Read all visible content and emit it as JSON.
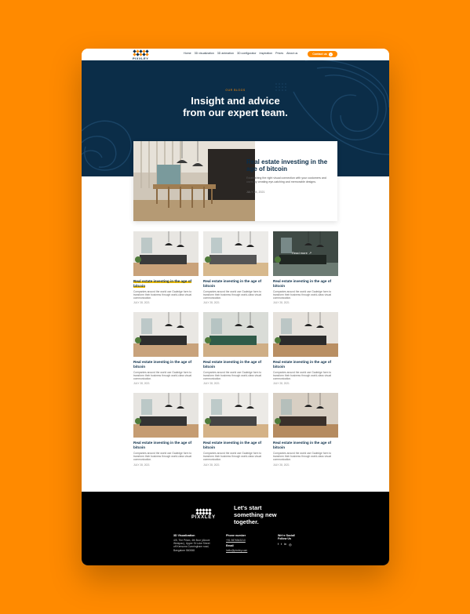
{
  "nav": {
    "logo_text": "PIXXLEY",
    "items": [
      "Home",
      "3D visualization",
      "3D animation",
      "3D configurator",
      "Inspiration",
      "Prices",
      "About us"
    ],
    "contact_label": "Contact us"
  },
  "hero": {
    "eyebrow": "OUR BLOGS",
    "title_line1": "Insight and advice",
    "title_line2": "from our expert team."
  },
  "featured": {
    "title": "Real estate investing in the age of bitcoin",
    "description": "Establishing the right visual connection with your customers and users by creating eye-catching and memorable designs.",
    "date": "JULY 28, 2021"
  },
  "cards": [
    {
      "title": "Real estate investing in the age of bitcoin",
      "desc": "Companies around the world use Gadedge form to transform their business through world-class visual communication.",
      "date": "JULY 28, 2021"
    },
    {
      "title": "Real estate investing in the age of bitcoin",
      "desc": "Companies around the world use Gadedge form to transform their business through world-class visual communication.",
      "date": "JULY 28, 2021"
    },
    {
      "title": "Real estate investing in the age of bitcoin",
      "desc": "Companies around the world use Gadedge form to transform their business through world-class visual communication.",
      "date": "JULY 28, 2021",
      "readmore": "Read more"
    },
    {
      "title": "Real estate investing in the age of bitcoin",
      "desc": "Companies around the world use Gadedge form to transform their business through world-class visual communication.",
      "date": "JULY 28, 2021"
    },
    {
      "title": "Real estate investing in the age of bitcoin",
      "desc": "Companies around the world use Gadedge form to transform their business through world-class visual communication.",
      "date": "JULY 28, 2021"
    },
    {
      "title": "Real estate investing in the age of bitcoin",
      "desc": "Companies around the world use Gadedge form to transform their business through world-class visual communication.",
      "date": "JULY 28, 2021"
    },
    {
      "title": "Real estate investing in the age of bitcoin",
      "desc": "Companies around the world use Gadedge form to transform their business through world-class visual communication.",
      "date": "JULY 28, 2021"
    },
    {
      "title": "Real estate investing in the age of bitcoin",
      "desc": "Companies around the world use Gadedge form to transform their business through world-class visual communication.",
      "date": "JULY 28, 2021"
    },
    {
      "title": "Real estate investing in the age of bitcoin",
      "desc": "Companies around the world use Gadedge form to transform their business through world-class visual communication.",
      "date": "JULY 28, 2021"
    }
  ],
  "footer": {
    "logo_text": "PIXXLEY",
    "cta_line1": "Let's start",
    "cta_line2": "something new",
    "cta_line3": "together.",
    "col1_heading": "3D Visualization",
    "col1_line1": "4/5, The Prism, 4th floor (Above",
    "col1_line2": "Westpac), Upper St Luke Street",
    "col1_line3": "off Kensons Cunningham road,",
    "col1_line4": "Bangalore 560068",
    "phone_heading": "Phone number",
    "phone_value": "+91 9876543210",
    "email_heading": "Email",
    "email_value": "hello@pixxley.com",
    "social_heading_1": "We're Social!",
    "social_heading_2": "Follow Us",
    "socials": [
      "f",
      "t",
      "in",
      "◎"
    ]
  },
  "colors": {
    "accent": "#ff8a00",
    "navy": "#0b2d48",
    "highlight": "#f5c000",
    "footer": "#000000"
  }
}
